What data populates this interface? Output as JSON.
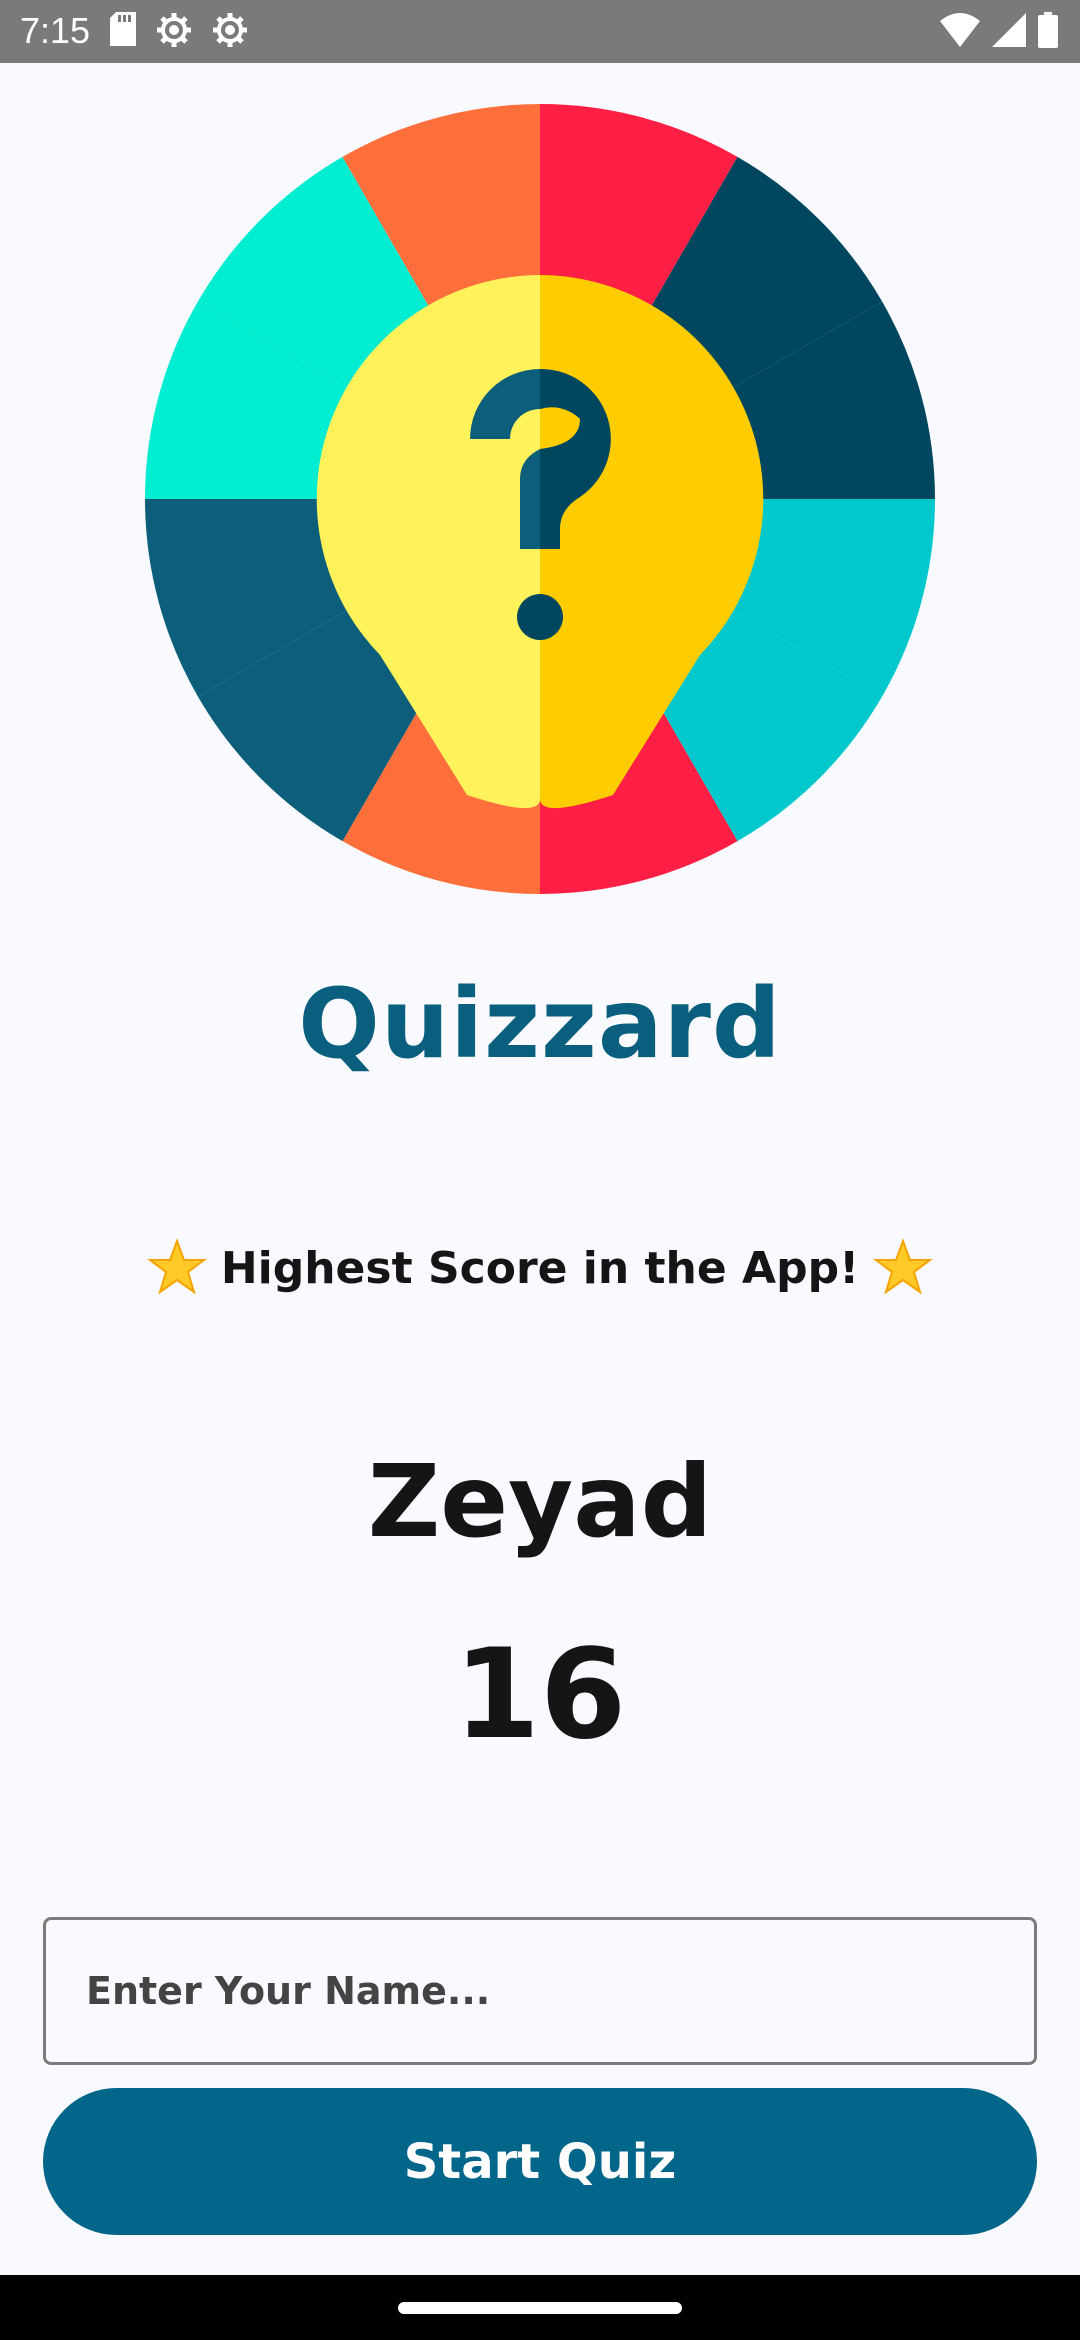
{
  "status_bar": {
    "time": "7:15",
    "left_icons": [
      "sd-card-icon",
      "settings-icon",
      "settings-icon"
    ],
    "right_icons": [
      "wifi-icon",
      "signal-icon",
      "battery-icon"
    ],
    "background": "#7A7A7A"
  },
  "app": {
    "logo_icon": "question-wheel-logo",
    "title": "Quizzard",
    "title_color": "#0A5F7E",
    "highscore_label": "Highest Score in the App!",
    "highscore_name": "Zeyad",
    "highscore_score": "16",
    "name_input": {
      "placeholder": "Enter Your Name...",
      "value": ""
    },
    "start_button_label": "Start Quiz",
    "button_color": "#02658A"
  }
}
